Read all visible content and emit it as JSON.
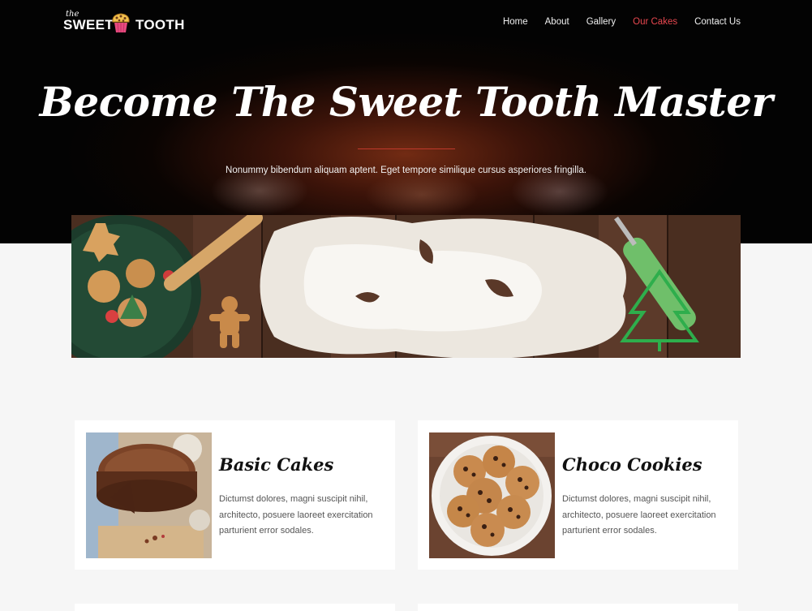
{
  "brand": {
    "the": "the",
    "sweet": "SWEET",
    "tooth": "TOOTH"
  },
  "nav": {
    "items": [
      {
        "label": "Home"
      },
      {
        "label": "About"
      },
      {
        "label": "Gallery"
      },
      {
        "label": "Our Cakes"
      },
      {
        "label": "Contact Us"
      }
    ],
    "active_color": "#e8474f"
  },
  "hero": {
    "title": "Become The Sweet Tooth Master",
    "subtitle": "Nonummy bibendum aliquam aptent. Eget tempore similique cursus asperiores fringilla."
  },
  "cards": [
    {
      "title": "Basic Cakes",
      "text": "Dictumst dolores, magni suscipit nihil, architecto, posuere laoreet exercitation parturient error sodales."
    },
    {
      "title": "Choco Cookies",
      "text": "Dictumst dolores, magni suscipit nihil, architecto, posuere laoreet exercitation parturient error sodales."
    }
  ]
}
